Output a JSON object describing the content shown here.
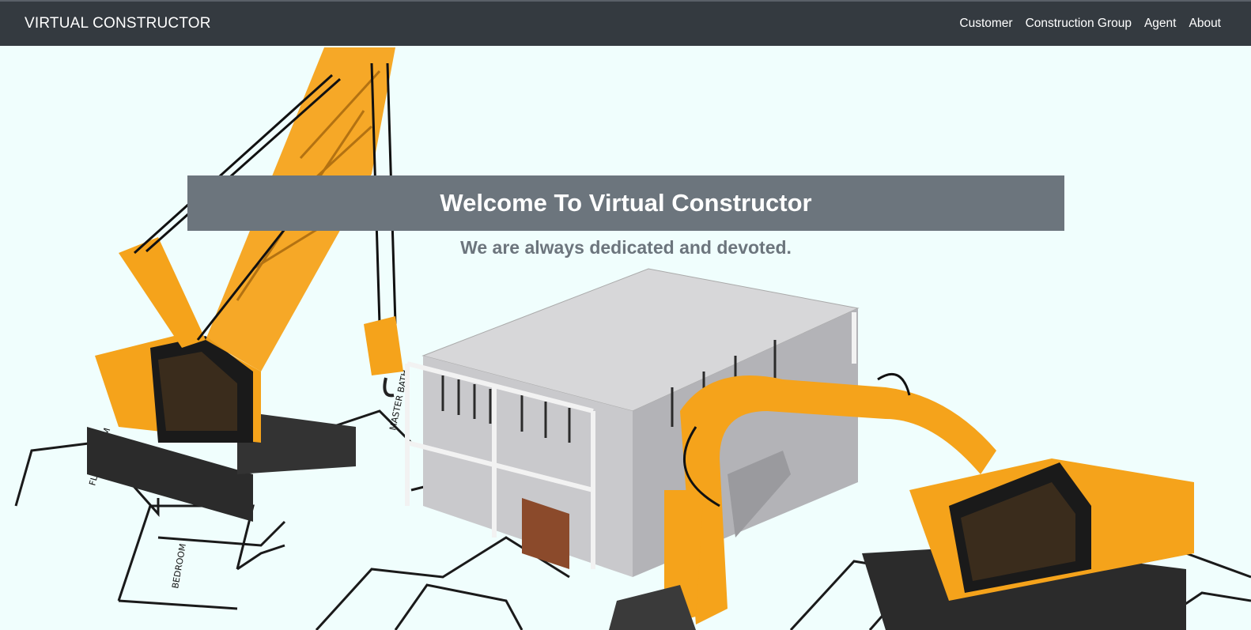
{
  "navbar": {
    "brand": "VIRTUAL CONSTRUCTOR",
    "links": [
      {
        "label": "Customer"
      },
      {
        "label": "Construction Group"
      },
      {
        "label": "Agent"
      },
      {
        "label": "About"
      }
    ]
  },
  "hero": {
    "title": "Welcome To Virtual Constructor",
    "subtitle": "We are always dedicated and devoted.",
    "background_color": "#f0fefd",
    "banner_color": "#6c757d",
    "machine_color": "#f5a31b"
  }
}
